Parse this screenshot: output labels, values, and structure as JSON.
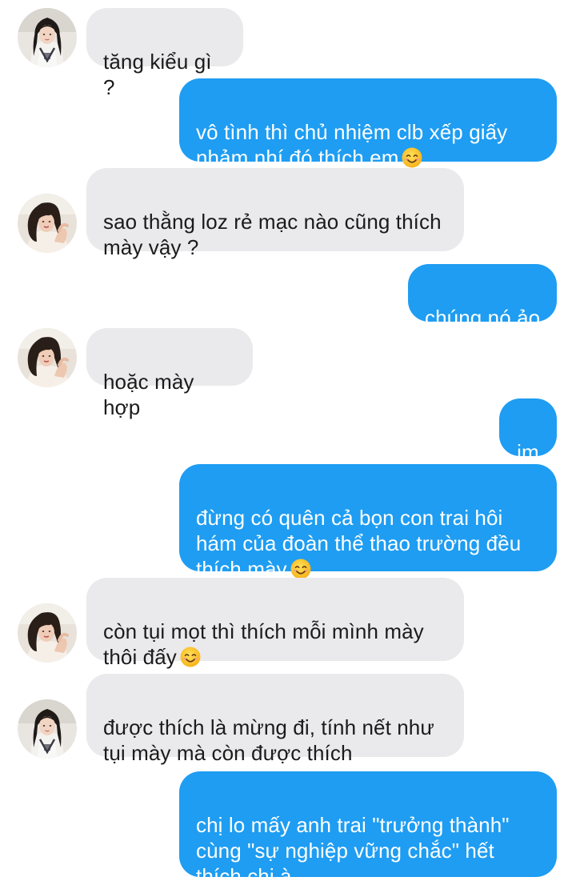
{
  "conversation": {
    "messages": [
      {
        "id": "m1",
        "side": "incoming",
        "avatar": "avatar-a",
        "text": "tăng kiểu gì ?"
      },
      {
        "id": "m2",
        "side": "outgoing",
        "text": "vô tình thì chủ nhiệm clb xếp giấy\nnhảm nhí đó thích em",
        "emoji": "smiling-face-emoji"
      },
      {
        "id": "m3",
        "side": "incoming",
        "avatar": "avatar-b",
        "text": "sao thằng loz rẻ mạc nào cũng thích\nmày vậy ?"
      },
      {
        "id": "m4",
        "side": "outgoing",
        "text": "chúng nó ảo"
      },
      {
        "id": "m5",
        "side": "incoming",
        "avatar": "avatar-b",
        "text": "hoặc mày hợp"
      },
      {
        "id": "m6",
        "side": "outgoing",
        "text": "im"
      },
      {
        "id": "m7",
        "side": "outgoing",
        "text": "đừng có quên cả bọn con trai hôi\nhám của đoàn thể thao trường đều\nthích mày",
        "emoji": "smiling-face-emoji"
      },
      {
        "id": "m8",
        "side": "incoming",
        "avatar": "avatar-b",
        "text": "còn tụi mọt thì thích mỗi mình mày\nthôi đấy",
        "emoji": "smiling-face-emoji"
      },
      {
        "id": "m9",
        "side": "incoming",
        "avatar": "avatar-a",
        "text": "được thích là mừng đi, tính nết như\ntụi mày mà còn được thích"
      },
      {
        "id": "m10",
        "side": "outgoing",
        "text": "chị lo mấy anh trai \"trưởng thành\"\ncùng \"sự nghiệp vững chắc\" hết\nthích chị à"
      }
    ]
  },
  "colors": {
    "incoming_bubble": "#eaeaec",
    "incoming_text": "#1b1b1b",
    "outgoing_bubble": "#1e9df2",
    "outgoing_text": "#ffffff",
    "background": "#ffffff"
  }
}
